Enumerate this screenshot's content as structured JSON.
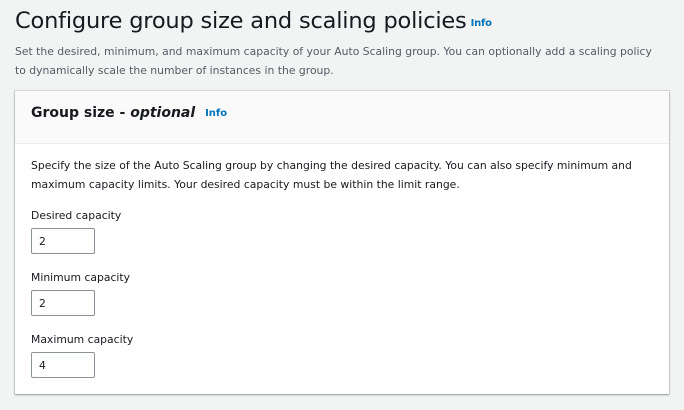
{
  "header": {
    "title": "Configure group size and scaling policies",
    "info_label": "Info",
    "description": "Set the desired, minimum, and maximum capacity of your Auto Scaling group. You can optionally add a scaling policy to dynamically scale the number of instances in the group."
  },
  "group_size": {
    "title": "Group size -",
    "optional_label": "optional",
    "info_label": "Info",
    "description": "Specify the size of the Auto Scaling group by changing the desired capacity. You can also specify minimum and maximum capacity limits. Your desired capacity must be within the limit range.",
    "desired": {
      "label": "Desired capacity",
      "value": "2"
    },
    "minimum": {
      "label": "Minimum capacity",
      "value": "2"
    },
    "maximum": {
      "label": "Maximum capacity",
      "value": "4"
    }
  }
}
